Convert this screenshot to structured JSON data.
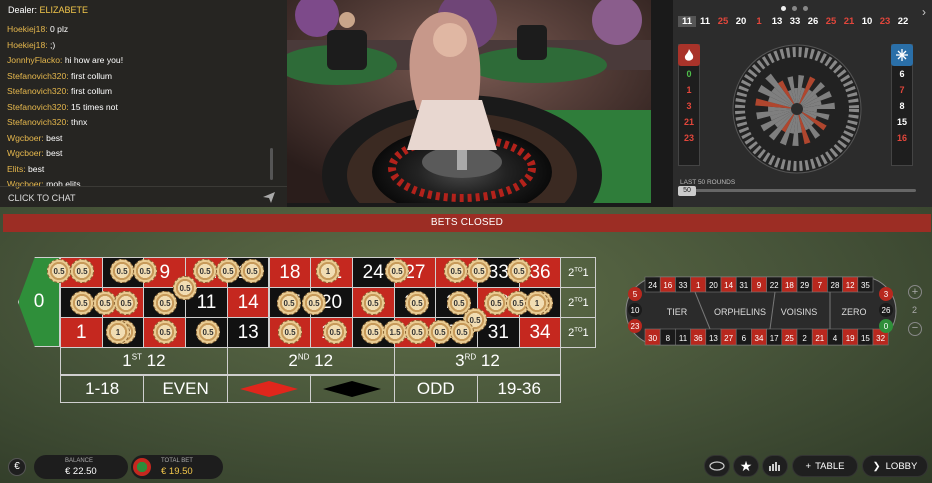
{
  "chat": {
    "dealer_prefix": "Dealer:",
    "dealer_name": "ELIZABETE",
    "messages": [
      {
        "user": "Hoekiej18:",
        "text": "0 plz"
      },
      {
        "user": "Hoekiej18:",
        "text": ";)"
      },
      {
        "user": "JonnhyFlacko:",
        "text": "hi how are you!"
      },
      {
        "user": "Stefanovich320:",
        "text": "first collum"
      },
      {
        "user": "Stefanovich320:",
        "text": "first collum"
      },
      {
        "user": "Stefanovich320:",
        "text": "15 times not"
      },
      {
        "user": "Stefanovich320:",
        "text": "thnx"
      },
      {
        "user": "Wgcboer:",
        "text": "best"
      },
      {
        "user": "Wgcboer:",
        "text": "best"
      },
      {
        "user": "Elits:",
        "text": "best"
      },
      {
        "user": "Wgcboer:",
        "text": "moh elits"
      }
    ],
    "input_placeholder": "CLICK TO CHAT"
  },
  "stats": {
    "history": [
      {
        "n": "11",
        "c": "#ffffff"
      },
      {
        "n": "11",
        "c": "#ffffff"
      },
      {
        "n": "25",
        "c": "#e2463b"
      },
      {
        "n": "20",
        "c": "#ffffff"
      },
      {
        "n": "1",
        "c": "#e2463b"
      },
      {
        "n": "13",
        "c": "#ffffff"
      },
      {
        "n": "33",
        "c": "#ffffff"
      },
      {
        "n": "26",
        "c": "#ffffff"
      },
      {
        "n": "25",
        "c": "#e2463b"
      },
      {
        "n": "21",
        "c": "#e2463b"
      },
      {
        "n": "10",
        "c": "#ffffff"
      },
      {
        "n": "23",
        "c": "#e2463b"
      },
      {
        "n": "22",
        "c": "#ffffff"
      }
    ],
    "hot": [
      {
        "n": "0",
        "c": "#4fbf4a"
      },
      {
        "n": "1",
        "c": "#e2463b"
      },
      {
        "n": "3",
        "c": "#e2463b"
      },
      {
        "n": "21",
        "c": "#e2463b"
      },
      {
        "n": "23",
        "c": "#e2463b"
      }
    ],
    "cold": [
      {
        "n": "6",
        "c": "#ffffff"
      },
      {
        "n": "7",
        "c": "#e2463b"
      },
      {
        "n": "8",
        "c": "#ffffff"
      },
      {
        "n": "15",
        "c": "#ffffff"
      },
      {
        "n": "16",
        "c": "#e2463b"
      }
    ],
    "last_rounds_label": "LAST 50 ROUNDS",
    "rounds_value": "50",
    "hot_icon": "flame-icon",
    "cold_icon": "snowflake-icon"
  },
  "banner": "BETS CLOSED",
  "grid": {
    "zero": "0",
    "rows": [
      [
        "3",
        "6",
        "9",
        "12",
        "15",
        "18",
        "21",
        "24",
        "27",
        "30",
        "33",
        "36"
      ],
      [
        "2",
        "5",
        "8",
        "11",
        "14",
        "17",
        "20",
        "23",
        "26",
        "29",
        "32",
        "35"
      ],
      [
        "1",
        "4",
        "7",
        "10",
        "13",
        "16",
        "19",
        "22",
        "25",
        "28",
        "31",
        "34"
      ]
    ],
    "red_numbers": [
      "1",
      "3",
      "5",
      "7",
      "9",
      "12",
      "14",
      "16",
      "18",
      "19",
      "21",
      "23",
      "25",
      "27",
      "30",
      "32",
      "34",
      "36"
    ],
    "col_bet_label": "2TO1",
    "dozens": [
      {
        "num": "1",
        "sup": "ST",
        "rest": "12"
      },
      {
        "num": "2",
        "sup": "ND",
        "rest": "12"
      },
      {
        "num": "3",
        "sup": "RD",
        "rest": "12"
      }
    ],
    "outside": [
      "1-18",
      "EVEN",
      "",
      "",
      "ODD",
      "19-36"
    ],
    "chip_value": "0.5",
    "chip_value_alt": "1.5"
  },
  "racetrack": {
    "top": [
      "24",
      "16",
      "33",
      "1",
      "20",
      "14",
      "31",
      "9",
      "22",
      "18",
      "29",
      "7",
      "28",
      "12",
      "35"
    ],
    "bottom": [
      "30",
      "8",
      "11",
      "36",
      "13",
      "27",
      "6",
      "34",
      "17",
      "25",
      "2",
      "21",
      "4",
      "19",
      "15",
      "32"
    ],
    "left_end": [
      "5",
      "10",
      "23"
    ],
    "right_end": [
      "3",
      "26",
      "0"
    ],
    "sections": [
      "TIER",
      "ORPHELINS",
      "VOISINS",
      "ZERO"
    ],
    "neighbour_count": "2"
  },
  "footer": {
    "balance_label": "BALANCE",
    "balance": "€ 22.50",
    "total_bet_label": "TOTAL BET",
    "total_bet": "€ 19.50",
    "table_button": "TABLE",
    "lobby_button": "LOBBY"
  },
  "colors": {
    "red": "#c5281f",
    "black": "#111111",
    "felt": "#4b5a3a",
    "banner": "#9c2d24",
    "gold": "#f3c74b"
  }
}
